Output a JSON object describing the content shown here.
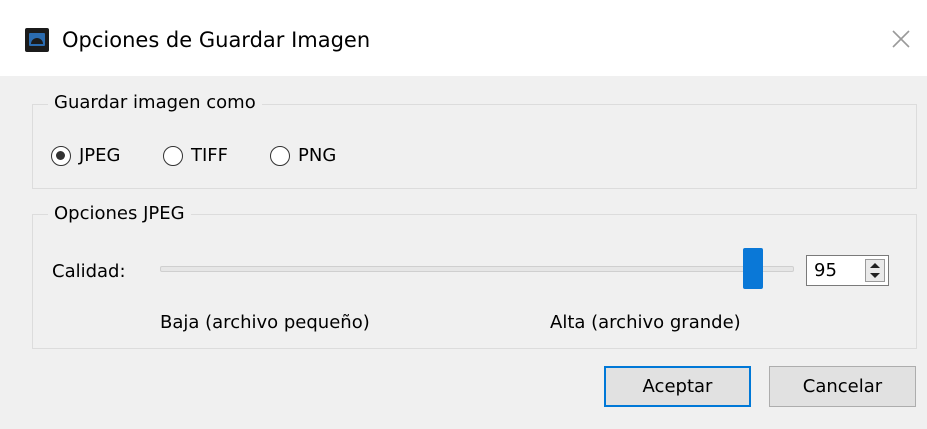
{
  "window": {
    "title": "Opciones de Guardar Imagen",
    "icon": "app-image-icon",
    "close_icon": "close-icon"
  },
  "format_group": {
    "legend": "Guardar imagen como",
    "options": [
      {
        "label": "JPEG",
        "selected": true
      },
      {
        "label": "TIFF",
        "selected": false
      },
      {
        "label": "PNG",
        "selected": false
      }
    ]
  },
  "jpeg_group": {
    "legend": "Opciones JPEG",
    "quality_label": "Calidad:",
    "quality_value": "95",
    "quality_slider_level": 0.95,
    "scale_low": "Baja (archivo pequeño)",
    "scale_high": "Alta (archivo grande)"
  },
  "buttons": {
    "accept": "Aceptar",
    "cancel": "Cancelar"
  },
  "colors": {
    "accent": "#0078d7",
    "slider_thumb": "#0a78d7"
  }
}
